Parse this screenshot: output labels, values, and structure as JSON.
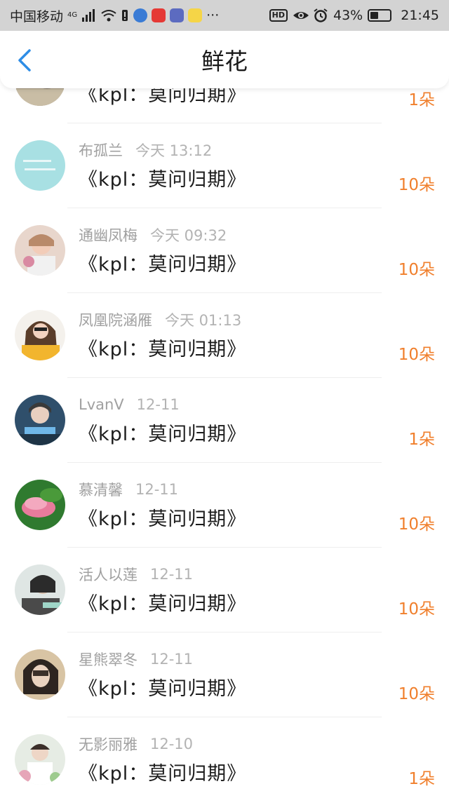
{
  "status_bar": {
    "carrier": "中国移动",
    "network": "4G",
    "hd": "HD",
    "battery": "43%",
    "battery_level": 0.43,
    "time": "21:45",
    "more": "···"
  },
  "header": {
    "title": "鲜花",
    "back_icon": "chevron-left-icon"
  },
  "rows": [
    {
      "name": "",
      "time": "",
      "title": "《kpl：莫问归期》",
      "count": "1朵"
    },
    {
      "name": "布孤兰",
      "time": "今天 13:12",
      "title": "《kpl：莫问归期》",
      "count": "10朵"
    },
    {
      "name": "通幽凤梅",
      "time": "今天 09:32",
      "title": "《kpl：莫问归期》",
      "count": "10朵"
    },
    {
      "name": "凤凰院涵雁",
      "time": "今天 01:13",
      "title": "《kpl：莫问归期》",
      "count": "10朵"
    },
    {
      "name": "LvanV",
      "time": "12-11",
      "title": "《kpl：莫问归期》",
      "count": "1朵"
    },
    {
      "name": "慕清馨",
      "time": "12-11",
      "title": "《kpl：莫问归期》",
      "count": "10朵"
    },
    {
      "name": "活人以莲",
      "time": "12-11",
      "title": "《kpl：莫问归期》",
      "count": "10朵"
    },
    {
      "name": "星熊翠冬",
      "time": "12-11",
      "title": "《kpl：莫问归期》",
      "count": "10朵"
    },
    {
      "name": "无影丽雅",
      "time": "12-10",
      "title": "《kpl：莫问归期》",
      "count": "1朵"
    }
  ],
  "colors": {
    "count": "#f07f2c",
    "back": "#2e8de6",
    "status_bg": "#d3d3d3"
  }
}
